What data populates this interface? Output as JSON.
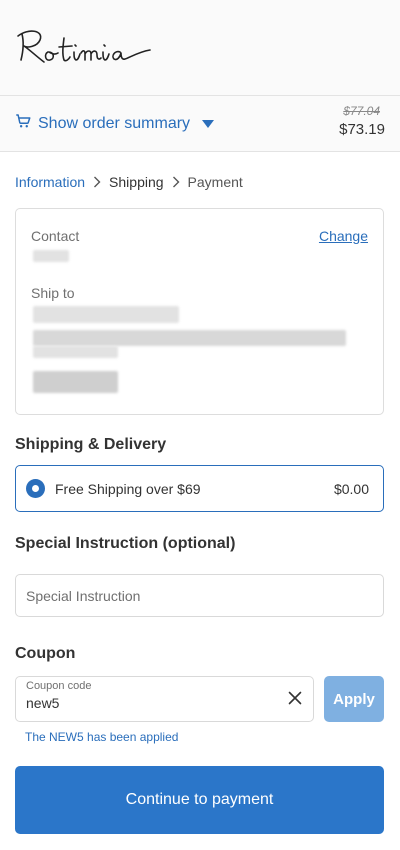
{
  "header": {
    "logo_text": "Rotimia"
  },
  "order_summary": {
    "toggle_label": "Show order summary",
    "original_price": "$77.04",
    "total_price": "$73.19"
  },
  "breadcrumb": {
    "items": [
      "Information",
      "Shipping",
      "Payment"
    ]
  },
  "review": {
    "contact_label": "Contact",
    "change_label": "Change",
    "ship_to_label": "Ship to"
  },
  "shipping": {
    "title": "Shipping & Delivery",
    "option_name": "Free Shipping over $69",
    "option_price": "$0.00",
    "option_selected": true
  },
  "special_instruction": {
    "title": "Special Instruction (optional)",
    "placeholder": "Special Instruction",
    "value": ""
  },
  "coupon": {
    "title": "Coupon",
    "field_label": "Coupon code",
    "value": "new5",
    "apply_label": "Apply",
    "message": "The NEW5 has been applied"
  },
  "actions": {
    "continue_label": "Continue to payment"
  },
  "colors": {
    "accent": "#2a6ebb",
    "button_primary": "#2b76c9",
    "button_disabled": "#7fb0e1",
    "border": "#dddddd"
  }
}
